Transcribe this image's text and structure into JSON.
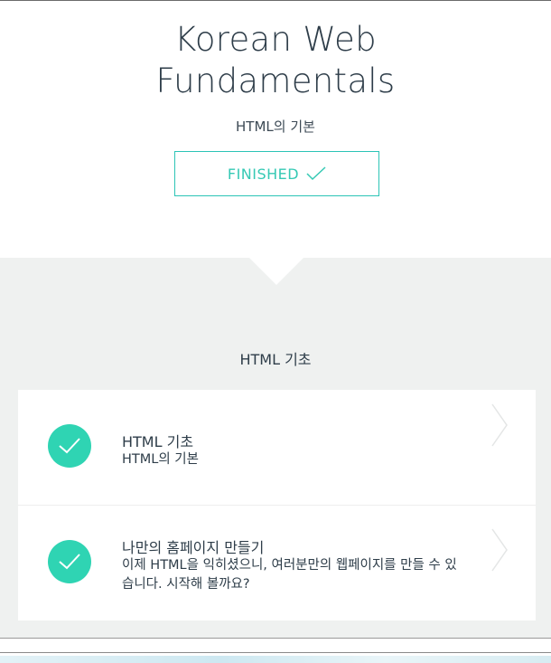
{
  "header": {
    "title_line1": "Korean Web",
    "title_line2": "Fundamentals",
    "subtitle": "HTML의 기본",
    "finished_label": "FINISHED"
  },
  "section": {
    "title": "HTML 기초"
  },
  "lessons": [
    {
      "title": "HTML 기초",
      "description": "HTML의 기본",
      "completed": true
    },
    {
      "title": "나만의 홈페이지 만들기",
      "description": "이제 HTML을 익히셨으니, 여러분만의 웹페이지를 만들 수 있습니다. 시작해 볼까요?",
      "completed": true
    }
  ],
  "colors": {
    "accent": "#2fd4b3",
    "button_border": "#2cc4b6",
    "gray_bg": "#eff1f0",
    "text": "#2e3d49"
  },
  "icons": {
    "finished": "check-icon",
    "lesson_complete": "check-circle-icon",
    "lesson_open": "chevron-right-icon"
  }
}
